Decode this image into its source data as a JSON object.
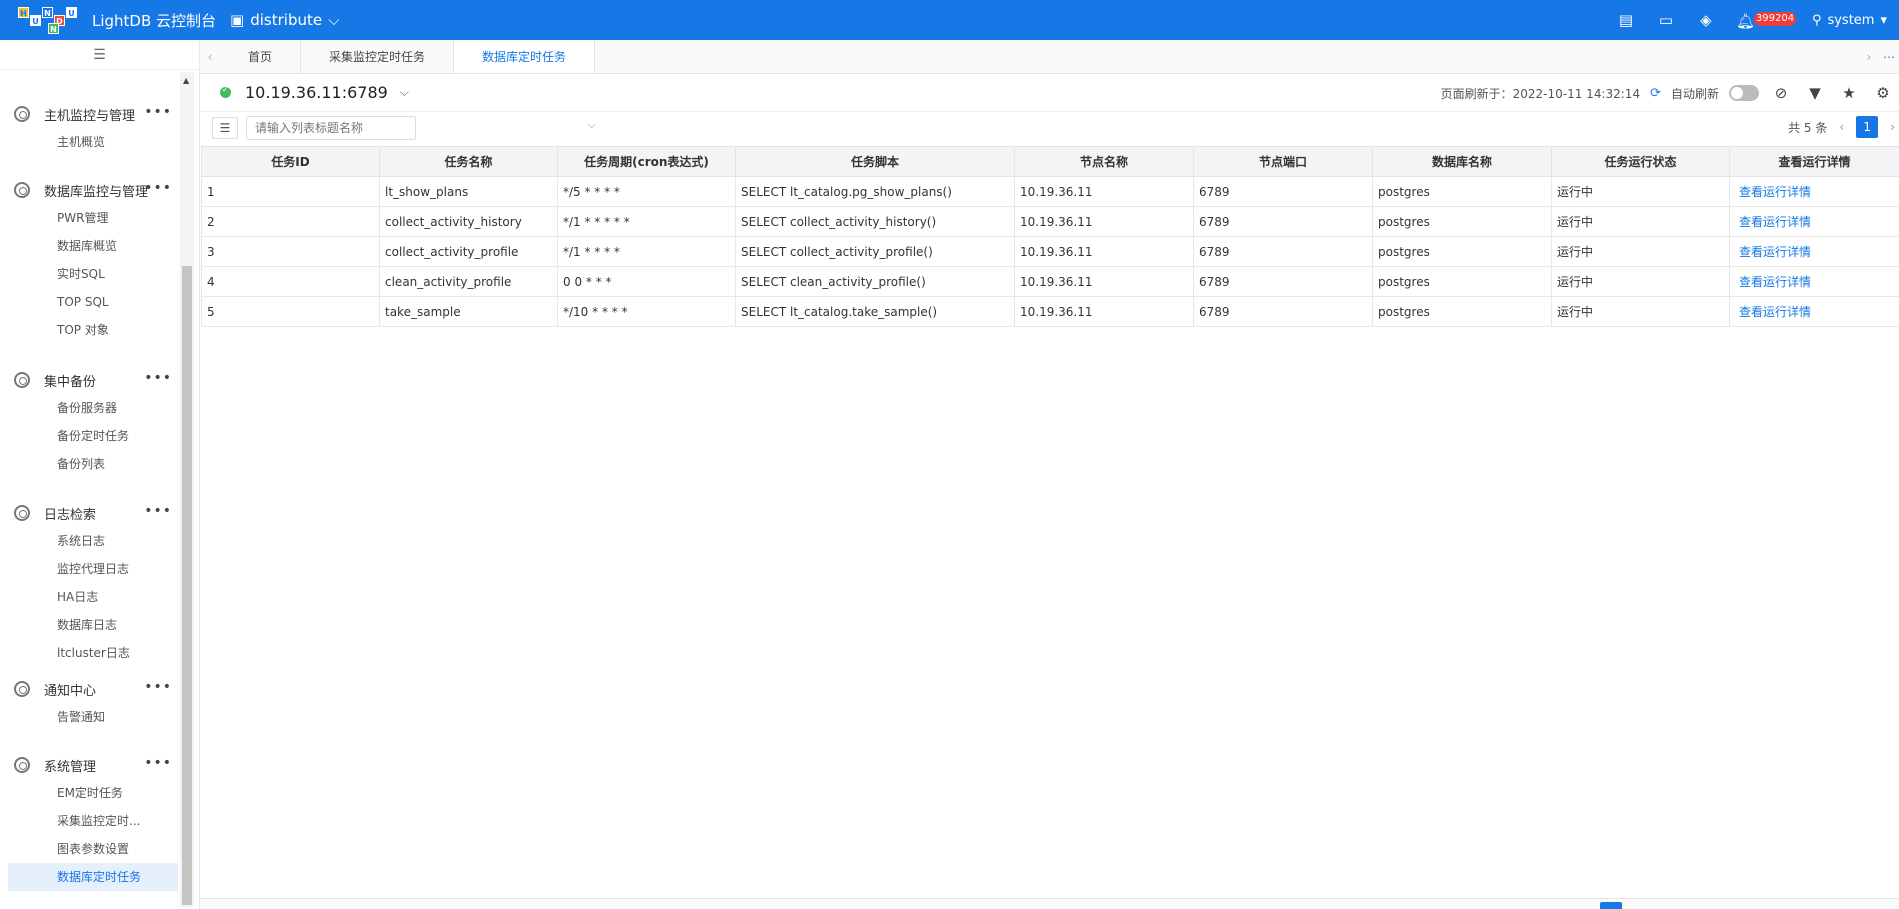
{
  "topbar": {
    "logo_letters": [
      "H",
      "U",
      "N",
      "D",
      "U",
      "N"
    ],
    "app_title": "LightDB 云控制台",
    "cluster": "distribute",
    "icons": [
      "report-icon",
      "terminal-icon",
      "cube-icon",
      "bell-icon"
    ],
    "badge_count": "399204",
    "user": "system",
    "brand_color": "#1677e6"
  },
  "sidebar": {
    "collapse_icon": "menu-fold-icon",
    "groups": [
      {
        "title": "主机监控与管理",
        "items": [
          "主机概览"
        ]
      },
      {
        "title": "数据库监控与管理",
        "items": [
          "PWR管理",
          "数据库概览",
          "实时SQL",
          "TOP SQL",
          "TOP 对象"
        ]
      },
      {
        "title": "集中备份",
        "items": [
          "备份服务器",
          "备份定时任务",
          "备份列表"
        ]
      },
      {
        "title": "日志检索",
        "items": [
          "系统日志",
          "监控代理日志",
          "HA日志",
          "数据库日志",
          "ltcluster日志"
        ]
      },
      {
        "title": "通知中心",
        "items": [
          "告警通知"
        ]
      },
      {
        "title": "系统管理",
        "items": [
          "EM定时任务",
          "采集监控定时...",
          "图表参数设置",
          "数据库定时任务"
        ]
      }
    ],
    "active_item": "数据库定时任务"
  },
  "tabs": [
    {
      "label": "首页",
      "active": false
    },
    {
      "label": "采集监控定时任务",
      "active": false
    },
    {
      "label": "数据库定时任务",
      "active": true
    }
  ],
  "header": {
    "address": "10.19.36.11:6789",
    "refresh_label": "页面刷新于：2022-10-11 14:32:14",
    "auto_refresh_label": "自动刷新",
    "auto_refresh_on": false
  },
  "toolbar": {
    "search_placeholder": "请输入列表标题名称",
    "total": "共 5 条",
    "page": "1"
  },
  "table": {
    "columns": [
      "任务ID",
      "任务名称",
      "任务周期(cron表达式)",
      "任务脚本",
      "节点名称",
      "节点端口",
      "数据库名称",
      "任务运行状态",
      "查看运行详情"
    ],
    "rows": [
      [
        "1",
        "lt_show_plans",
        "*/5 * * * *",
        "SELECT lt_catalog.pg_show_plans()",
        "10.19.36.11",
        "6789",
        "postgres",
        "运行中",
        "查看运行详情"
      ],
      [
        "2",
        "collect_activity_history",
        "*/1 * * * * *",
        "SELECT collect_activity_history()",
        "10.19.36.11",
        "6789",
        "postgres",
        "运行中",
        "查看运行详情"
      ],
      [
        "3",
        "collect_activity_profile",
        "*/1 * * * *",
        "SELECT collect_activity_profile()",
        "10.19.36.11",
        "6789",
        "postgres",
        "运行中",
        "查看运行详情"
      ],
      [
        "4",
        "clean_activity_profile",
        "0 0 * * *",
        "SELECT clean_activity_profile()",
        "10.19.36.11",
        "6789",
        "postgres",
        "运行中",
        "查看运行详情"
      ],
      [
        "5",
        "take_sample",
        "*/10 * * * *",
        "SELECT lt_catalog.take_sample()",
        "10.19.36.11",
        "6789",
        "postgres",
        "运行中",
        "查看运行详情"
      ]
    ]
  }
}
